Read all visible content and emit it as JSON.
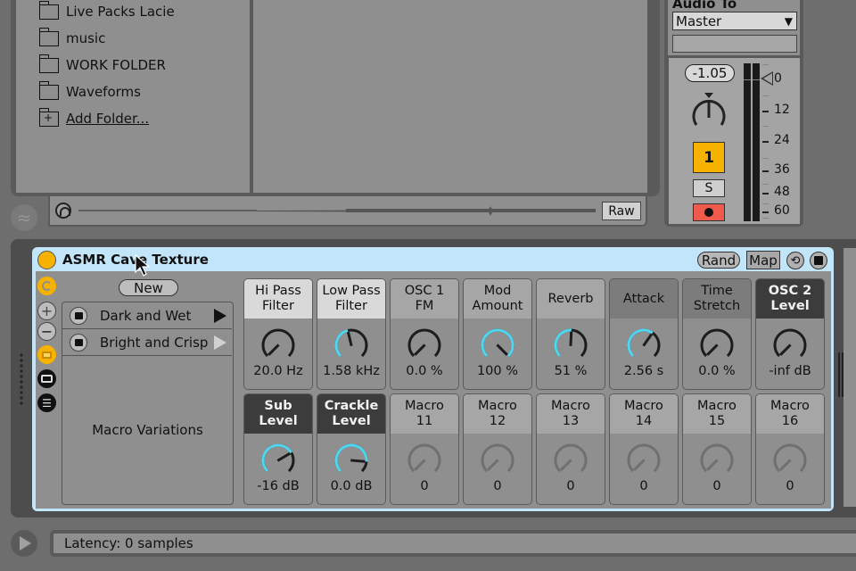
{
  "browser": {
    "places": [
      {
        "label": "Live Packs Lacie",
        "icon": "folder-icon"
      },
      {
        "label": "music",
        "icon": "folder-icon"
      },
      {
        "label": "WORK FOLDER",
        "icon": "folder-icon"
      },
      {
        "label": "Waveforms",
        "icon": "folder-icon"
      }
    ],
    "add_folder_label": "Add Folder...",
    "preview": {
      "raw_label": "Raw"
    }
  },
  "mixer": {
    "audio_to_label": "Audio To",
    "output_value": "Master",
    "pan_value": "-1.05",
    "track_number": "1",
    "solo_label": "S",
    "meter_scale": [
      "0",
      "12",
      "24",
      "36",
      "48",
      "60"
    ]
  },
  "device": {
    "title": "ASMR Cave Texture",
    "rand_label": "Rand",
    "map_label": "Map",
    "new_label": "New",
    "variations": [
      {
        "name": "Dark and Wet",
        "state": "active"
      },
      {
        "name": "Bright and Crisp",
        "state": "inactive"
      }
    ],
    "variations_label": "Macro Variations",
    "macros": [
      {
        "name": "Hi Pass\nFilter",
        "value": "20.0 Hz",
        "amount": 0.0,
        "style": "light",
        "enabled": true
      },
      {
        "name": "Low Pass\nFilter",
        "value": "1.58 kHz",
        "amount": 0.45,
        "style": "light",
        "enabled": true
      },
      {
        "name": "OSC 1\nFM",
        "value": "0.0 %",
        "amount": 0.0,
        "style": "mid",
        "enabled": true
      },
      {
        "name": "Mod\nAmount",
        "value": "100 %",
        "amount": 1.0,
        "style": "mid",
        "enabled": true
      },
      {
        "name": "Reverb",
        "value": "51 %",
        "amount": 0.51,
        "style": "mid",
        "enabled": true
      },
      {
        "name": "Attack",
        "value": "2.56 s",
        "amount": 0.63,
        "style": "grey",
        "enabled": true
      },
      {
        "name": "Time\nStretch",
        "value": "0.0 %",
        "amount": 0.0,
        "style": "grey",
        "enabled": true
      },
      {
        "name": "OSC 2\nLevel",
        "value": "-inf dB",
        "amount": 0.0,
        "style": "dark",
        "enabled": true
      },
      {
        "name": "Sub\nLevel",
        "value": "-16 dB",
        "amount": 0.72,
        "style": "dark",
        "enabled": true
      },
      {
        "name": "Crackle\nLevel",
        "value": "0.0 dB",
        "amount": 0.85,
        "style": "dark",
        "enabled": true
      },
      {
        "name": "Macro\n11",
        "value": "0",
        "amount": 0.0,
        "style": "mid",
        "enabled": false
      },
      {
        "name": "Macro\n12",
        "value": "0",
        "amount": 0.0,
        "style": "mid",
        "enabled": false
      },
      {
        "name": "Macro\n13",
        "value": "0",
        "amount": 0.0,
        "style": "mid",
        "enabled": false
      },
      {
        "name": "Macro\n14",
        "value": "0",
        "amount": 0.0,
        "style": "mid",
        "enabled": false
      },
      {
        "name": "Macro\n15",
        "value": "0",
        "amount": 0.0,
        "style": "mid",
        "enabled": false
      },
      {
        "name": "Macro\n16",
        "value": "0",
        "amount": 0.0,
        "style": "mid",
        "enabled": false
      }
    ]
  },
  "status": {
    "text": "Latency: 0 samples"
  },
  "colors": {
    "accent": "#f7b200",
    "knob_arc": "#4fd6f0",
    "arm": "#f05a4a",
    "device_header": "#c3e5f9"
  }
}
